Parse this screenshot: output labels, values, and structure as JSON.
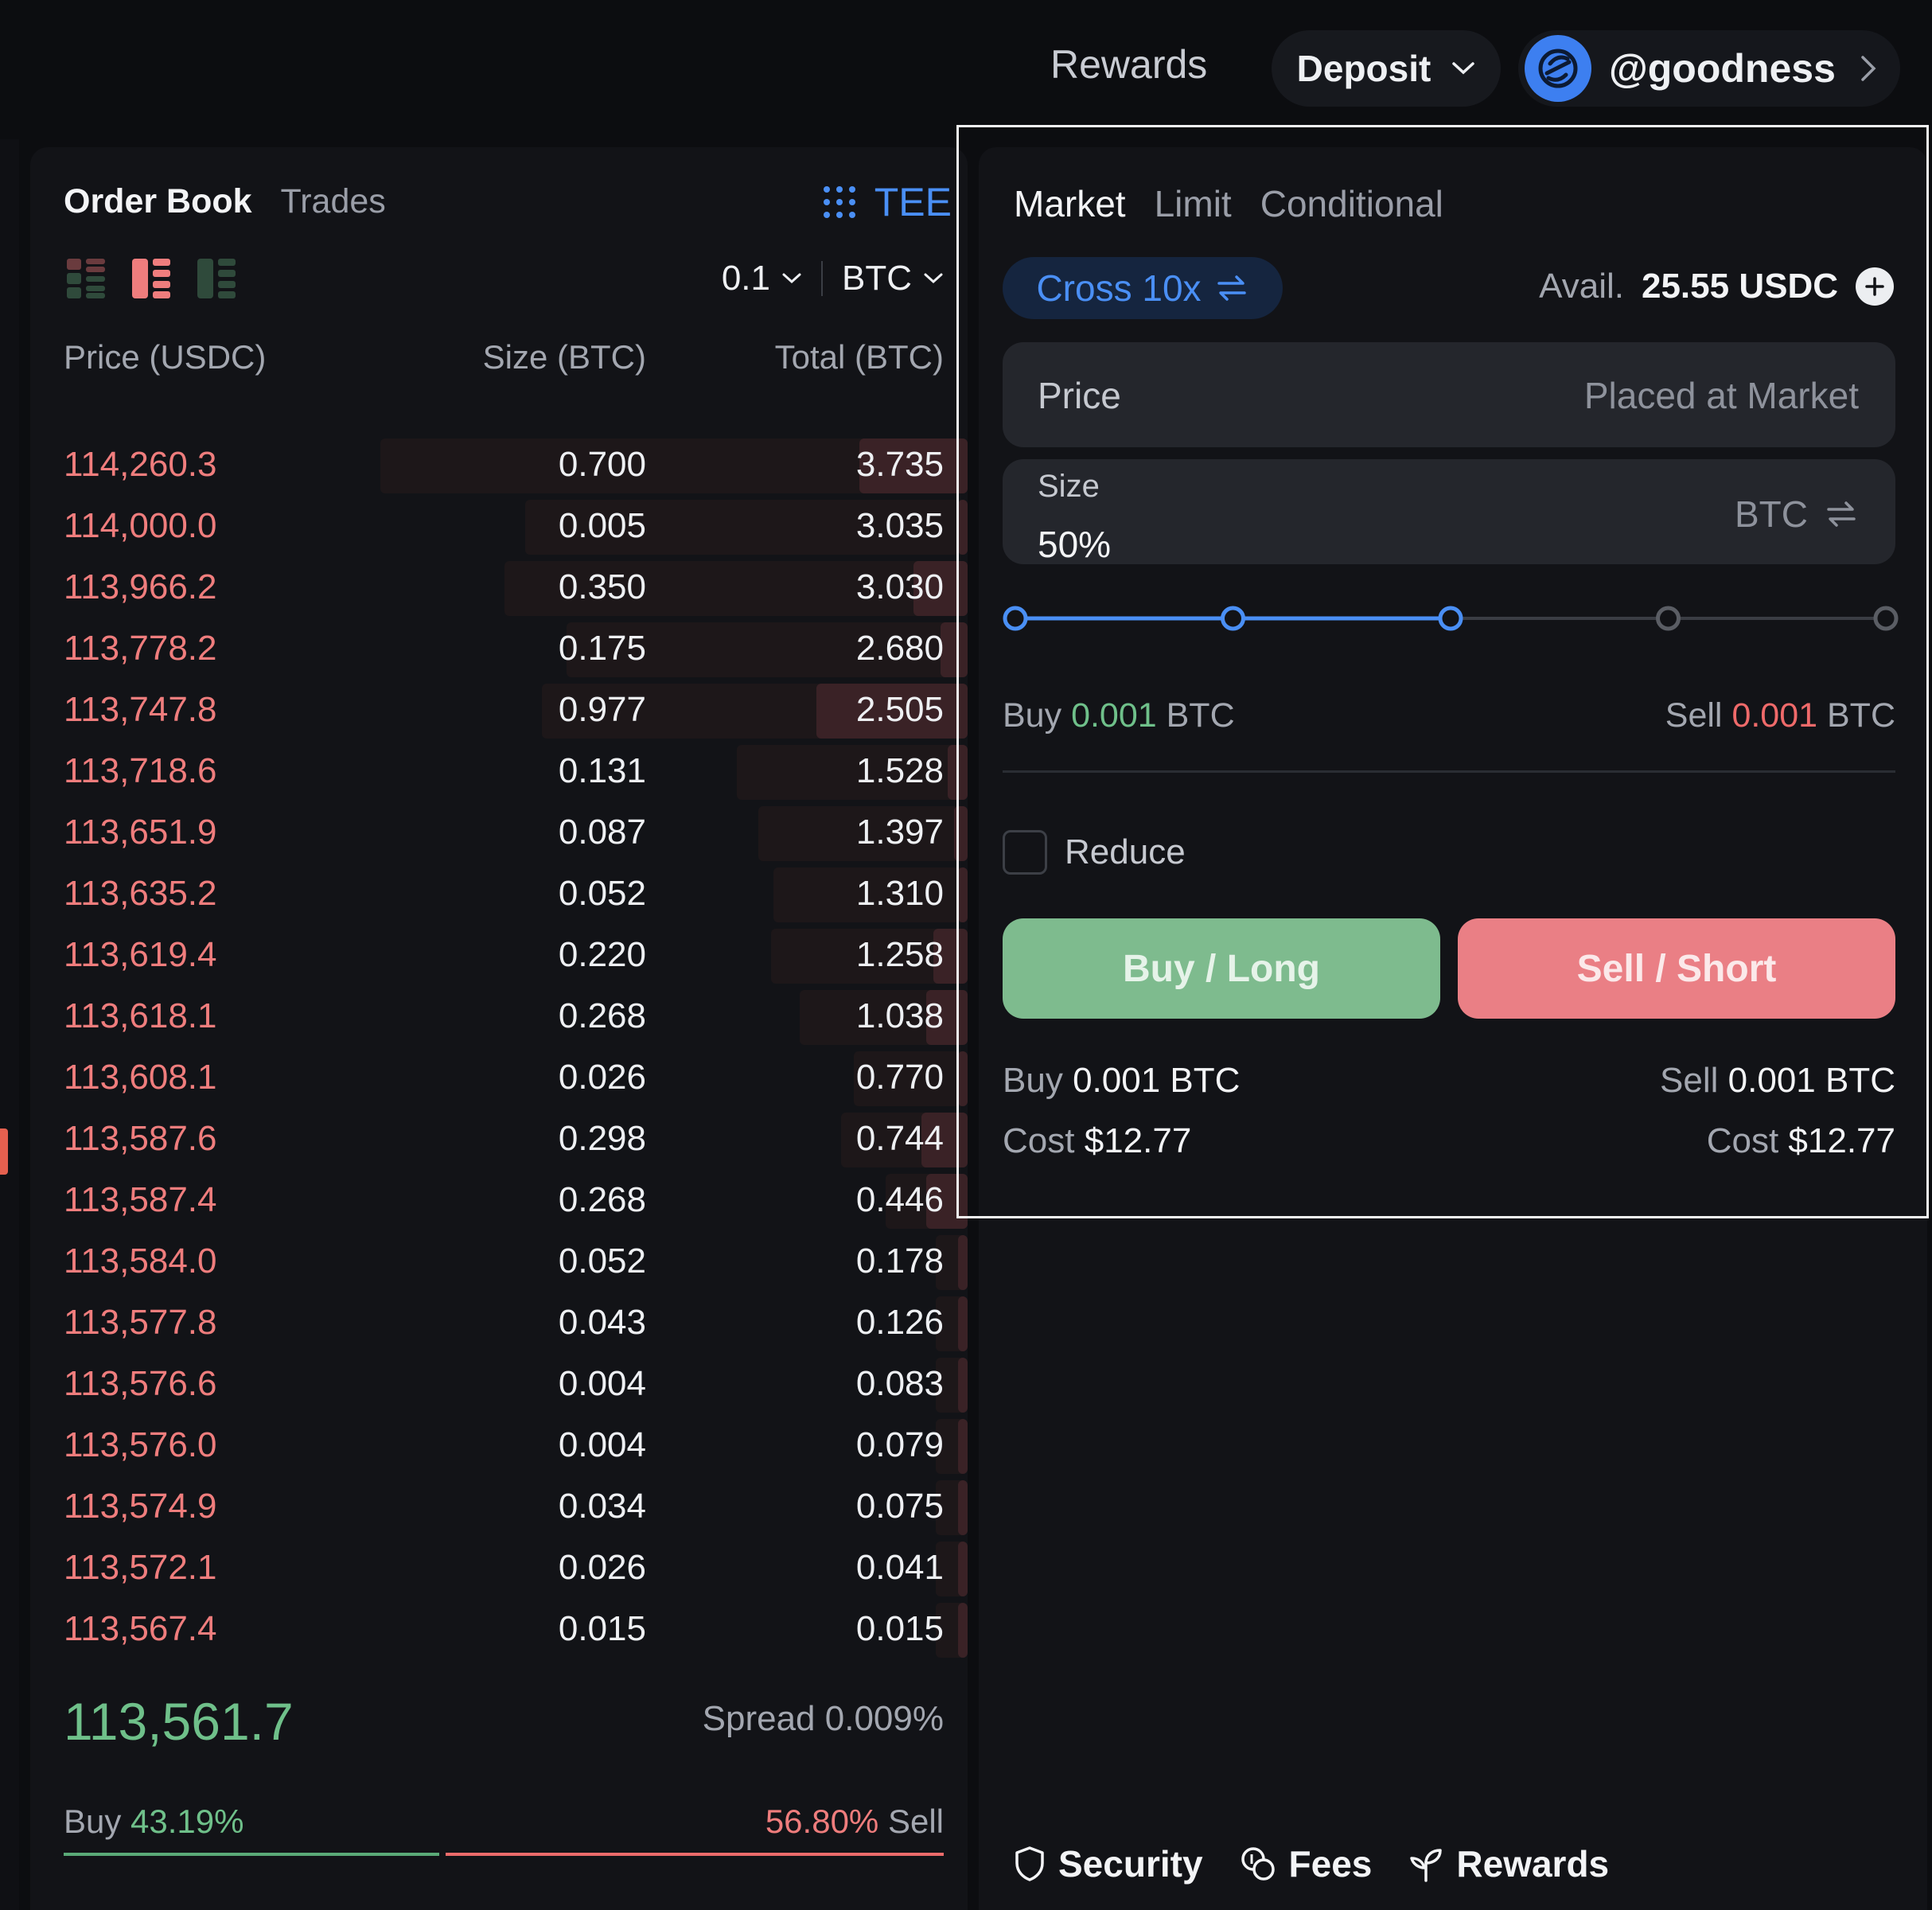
{
  "header": {
    "rewards_label": "Rewards",
    "deposit_label": "Deposit",
    "username": "@goodness"
  },
  "orderbook": {
    "tabs": [
      "Order Book",
      "Trades"
    ],
    "tee_label": "TEE",
    "tick_size": "0.1",
    "asset": "BTC",
    "columns": {
      "price": "Price (USDC)",
      "size": "Size (BTC)",
      "total": "Total (BTC)"
    },
    "asks": [
      {
        "price": "114,260.3",
        "size": "0.700",
        "total": "3.735"
      },
      {
        "price": "114,000.0",
        "size": "0.005",
        "total": "3.035"
      },
      {
        "price": "113,966.2",
        "size": "0.350",
        "total": "3.030"
      },
      {
        "price": "113,778.2",
        "size": "0.175",
        "total": "2.680"
      },
      {
        "price": "113,747.8",
        "size": "0.977",
        "total": "2.505"
      },
      {
        "price": "113,718.6",
        "size": "0.131",
        "total": "1.528"
      },
      {
        "price": "113,651.9",
        "size": "0.087",
        "total": "1.397"
      },
      {
        "price": "113,635.2",
        "size": "0.052",
        "total": "1.310"
      },
      {
        "price": "113,619.4",
        "size": "0.220",
        "total": "1.258"
      },
      {
        "price": "113,618.1",
        "size": "0.268",
        "total": "1.038"
      },
      {
        "price": "113,608.1",
        "size": "0.026",
        "total": "0.770"
      },
      {
        "price": "113,587.6",
        "size": "0.298",
        "total": "0.744"
      },
      {
        "price": "113,587.4",
        "size": "0.268",
        "total": "0.446"
      },
      {
        "price": "113,584.0",
        "size": "0.052",
        "total": "0.178"
      },
      {
        "price": "113,577.8",
        "size": "0.043",
        "total": "0.126"
      },
      {
        "price": "113,576.6",
        "size": "0.004",
        "total": "0.083"
      },
      {
        "price": "113,576.0",
        "size": "0.004",
        "total": "0.079"
      },
      {
        "price": "113,574.9",
        "size": "0.034",
        "total": "0.075"
      },
      {
        "price": "113,572.1",
        "size": "0.026",
        "total": "0.041"
      },
      {
        "price": "113,567.4",
        "size": "0.015",
        "total": "0.015"
      }
    ],
    "mid_price": "113,561.7",
    "spread_label": "Spread",
    "spread_value": "0.009%",
    "buy_label": "Buy",
    "buy_pct": "43.19%",
    "sell_label": "Sell",
    "sell_pct": "56.80%"
  },
  "trade": {
    "tabs": [
      "Market",
      "Limit",
      "Conditional"
    ],
    "margin_label": "Cross 10x",
    "avail_label": "Avail.",
    "avail_value": "25.55 USDC",
    "price_label": "Price",
    "price_placeholder": "Placed at Market",
    "size_label": "Size",
    "size_value": "50%",
    "size_unit": "BTC",
    "slider_percent": 50,
    "buy_label": "Buy",
    "buy_amount": "0.001",
    "sell_label": "Sell",
    "sell_amount": "0.001",
    "unit": "BTC",
    "reduce_label": "Reduce",
    "buy_button": "Buy / Long",
    "sell_button": "Sell / Short",
    "summary_buy": "0.001 BTC",
    "summary_sell": "0.001 BTC",
    "cost_label": "Cost",
    "cost_buy": "$12.77",
    "cost_sell": "$12.77"
  },
  "footer": {
    "security": "Security",
    "fees": "Fees",
    "rewards": "Rewards"
  },
  "colors": {
    "background": "#0c0d10",
    "panel": "#121317",
    "accent_blue": "#4a8ff5",
    "buy_green": "#6fc08a",
    "sell_red": "#ef7d7d",
    "buy_button": "#7ebb8e",
    "sell_button": "#ea7f85"
  }
}
